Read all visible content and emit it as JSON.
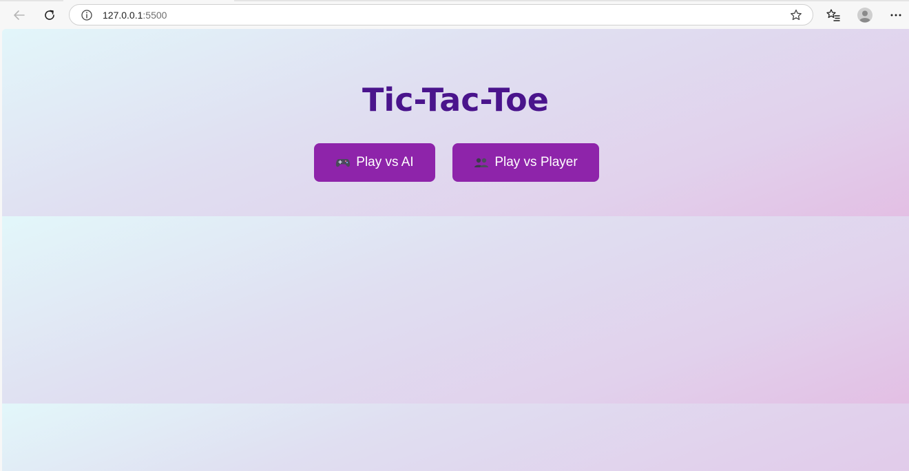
{
  "browser": {
    "url_host": "127.0.0.1",
    "url_port": ":5500",
    "icons": {
      "back": "back-arrow-icon",
      "reload": "reload-icon",
      "info": "info-icon",
      "favorite": "star-icon",
      "favorites_list": "favorites-list-icon",
      "profile": "profile-avatar-icon",
      "menu": "more-menu-icon"
    }
  },
  "page": {
    "title": "Tic-Tac-Toe",
    "buttons": {
      "play_ai": {
        "label": "Play vs AI",
        "icon": "gamepad-icon"
      },
      "play_player": {
        "label": "Play vs Player",
        "icon": "two-players-icon"
      }
    }
  },
  "colors": {
    "title": "#4a148c",
    "button_bg": "#8e24aa",
    "button_text": "#ffffff",
    "bg_start": "#e2f7fa",
    "bg_end": "#e3bfe4"
  }
}
